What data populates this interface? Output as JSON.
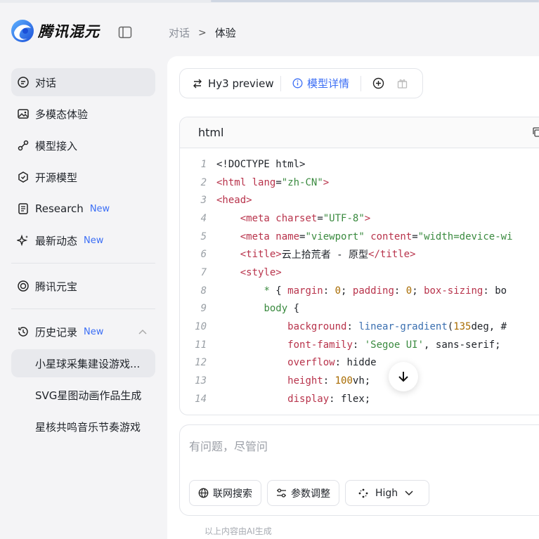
{
  "app": {
    "name": "腾讯混元"
  },
  "breadcrumb": {
    "parent": "对话",
    "separator": ">",
    "current": "体验"
  },
  "sidebar": {
    "nav": [
      {
        "label": "对话",
        "icon": "chat-icon",
        "active": true,
        "badge": ""
      },
      {
        "label": "多模态体验",
        "icon": "image-icon",
        "active": false,
        "badge": ""
      },
      {
        "label": "模型接入",
        "icon": "plug-icon",
        "active": false,
        "badge": ""
      },
      {
        "label": "开源模型",
        "icon": "cube-icon",
        "active": false,
        "badge": ""
      },
      {
        "label": "Research",
        "icon": "document-icon",
        "active": false,
        "badge": "New"
      },
      {
        "label": "最新动态",
        "icon": "sparkle-icon",
        "active": false,
        "badge": "New"
      }
    ],
    "yuanbao": {
      "label": "腾讯元宝",
      "icon": "yuanbao-icon"
    },
    "history": {
      "label": "历史记录",
      "badge": "New",
      "items": [
        {
          "label": "小星球采集建设游戏...",
          "active": true
        },
        {
          "label": "SVG星图动画作品生成",
          "active": false
        },
        {
          "label": "星核共鸣音乐节奏游戏",
          "active": false
        }
      ]
    }
  },
  "toolbar": {
    "model_label": "Hy3 preview",
    "detail_label": "模型详情"
  },
  "code_block": {
    "language": "html",
    "lines": [
      {
        "n": "1"
      },
      {
        "n": "2"
      },
      {
        "n": "3"
      },
      {
        "n": "4"
      },
      {
        "n": "5"
      },
      {
        "n": "6"
      },
      {
        "n": "7"
      },
      {
        "n": "8"
      },
      {
        "n": "9"
      },
      {
        "n": "10"
      },
      {
        "n": "11"
      },
      {
        "n": "12"
      },
      {
        "n": "13"
      },
      {
        "n": "14"
      }
    ],
    "tokens": {
      "l1": "<!DOCTYPE html>",
      "l2a": "<html",
      "l2b": " lang",
      "l2c": "=",
      "l2d": "\"zh-CN\"",
      "l2e": ">",
      "l3": "<head>",
      "l4a": "<meta",
      "l4b": " charset",
      "l4c": "=",
      "l4d": "\"UTF-8\"",
      "l4e": ">",
      "l5a": "<meta",
      "l5b": " name",
      "l5c": "=",
      "l5d": "\"viewport\"",
      "l5e": " content",
      "l5f": "=",
      "l5g": "\"width=device-wi",
      "l6a": "<title>",
      "l6b": "云上拾荒者 - 原型",
      "l6c": "</title>",
      "l7": "<style>",
      "l8a": "* ",
      "l8b": "{ ",
      "l8c": "margin",
      "l8d": ": ",
      "l8e": "0",
      "l8f": "; ",
      "l8g": "padding",
      "l8h": ": ",
      "l8i": "0",
      "l8j": "; ",
      "l8k": "box-sizing",
      "l8l": ": bo",
      "l9a": "body",
      "l9b": " {",
      "l10a": "background",
      "l10b": ": ",
      "l10c": "linear-gradient",
      "l10d": "(",
      "l10e": "135",
      "l10f": "deg, #",
      "l11a": "font-family",
      "l11b": ": ",
      "l11c": "'Segoe UI'",
      "l11d": ", sans-serif;",
      "l12a": "overflow",
      "l12b": ": hidde",
      "l13a": "height",
      "l13b": ": ",
      "l13c": "100",
      "l13d": "vh;",
      "l14a": "display",
      "l14b": ": flex;"
    }
  },
  "input": {
    "placeholder": "有问题，尽管问"
  },
  "chips": {
    "search_label": "联网搜索",
    "params_label": "参数调整",
    "mode_label": "High"
  },
  "footer": {
    "note": "以上内容由AI生成"
  }
}
